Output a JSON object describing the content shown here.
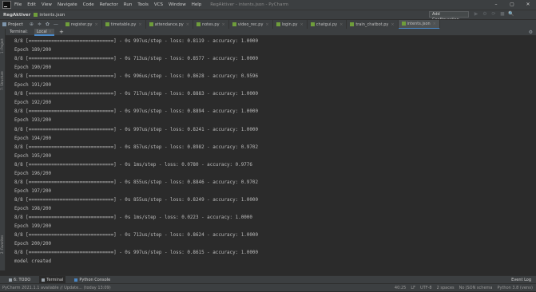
{
  "app": {
    "window_title": "RegAktiver - intents.json - PyCharm",
    "menu": [
      "File",
      "Edit",
      "View",
      "Navigate",
      "Code",
      "Refactor",
      "Run",
      "Tools",
      "VCS",
      "Window",
      "Help"
    ],
    "window_controls": [
      "–",
      "▢",
      "✕"
    ]
  },
  "navbar": {
    "project": "RegAktiver",
    "file": "intents.json",
    "add_configuration": "Add Configuration...",
    "buttons": [
      "▶",
      "⚙",
      "⟳",
      "■",
      "🔍"
    ]
  },
  "tabsrow": {
    "project_label": "Project",
    "tools": [
      "⊕",
      "≑",
      "✿",
      "—"
    ],
    "tabs": [
      {
        "label": "register.py",
        "active": false
      },
      {
        "label": "timetable.py",
        "active": false
      },
      {
        "label": "attendance.py",
        "active": false
      },
      {
        "label": "notes.py",
        "active": false
      },
      {
        "label": "video_rec.py",
        "active": false
      },
      {
        "label": "login.py",
        "active": false
      },
      {
        "label": "chatgui.py",
        "active": false
      },
      {
        "label": "train_chatbot.py",
        "active": false
      },
      {
        "label": "intents.json",
        "active": true
      }
    ]
  },
  "leftstrip": {
    "project": "1: Project",
    "structure": "7: Structure",
    "favorites": "2: Favorites"
  },
  "terminal": {
    "title": "Terminal:",
    "tab": "Local",
    "close": "×",
    "add": "+",
    "settings": "⚙",
    "lines": [
      "8/8 [==============================] - 0s 997us/step - loss: 0.8119 - accuracy: 1.0000",
      "Epoch 189/200",
      "8/8 [==============================] - 0s 713us/step - loss: 0.8577 - accuracy: 1.0000",
      "Epoch 190/200",
      "8/8 [==============================] - 0s 996us/step - loss: 0.8628 - accuracy: 0.9596",
      "Epoch 191/200",
      "8/8 [==============================] - 0s 717us/step - loss: 0.8883 - accuracy: 1.0000",
      "Epoch 192/200",
      "8/8 [==============================] - 0s 997us/step - loss: 0.8894 - accuracy: 1.0000",
      "Epoch 193/200",
      "8/8 [==============================] - 0s 997us/step - loss: 0.8241 - accuracy: 1.0000",
      "Epoch 194/200",
      "8/8 [==============================] - 0s 857us/step - loss: 0.8982 - accuracy: 0.9702",
      "Epoch 195/200",
      "8/8 [==============================] - 0s 1ms/step - loss: 0.0780 - accuracy: 0.9776",
      "Epoch 196/200",
      "8/8 [==============================] - 0s 855us/step - loss: 0.8846 - accuracy: 0.9702",
      "Epoch 197/200",
      "8/8 [==============================] - 0s 855us/step - loss: 0.8249 - accuracy: 1.0000",
      "Epoch 198/200",
      "8/8 [==============================] - 0s 1ms/step - loss: 0.0223 - accuracy: 1.0000",
      "Epoch 199/200",
      "8/8 [==============================] - 0s 712us/step - loss: 0.8624 - accuracy: 1.0000",
      "Epoch 200/200",
      "8/8 [==============================] - 0s 997us/step - loss: 0.8615 - accuracy: 1.0000",
      "model created"
    ]
  },
  "bottombar": {
    "todo": "6: TODO",
    "terminal": "Terminal",
    "python_console": "Python Console",
    "event_log": "Event Log"
  },
  "statusbar": {
    "message": "PyCharm 2021.1.1 available // Update... (today 13:09)",
    "position": "40:25",
    "line_sep": "LF",
    "encoding": "UTF-8",
    "indent": "2 spaces",
    "schema": "No JSON schema",
    "interpreter": "Python 3.8 (venv)"
  }
}
